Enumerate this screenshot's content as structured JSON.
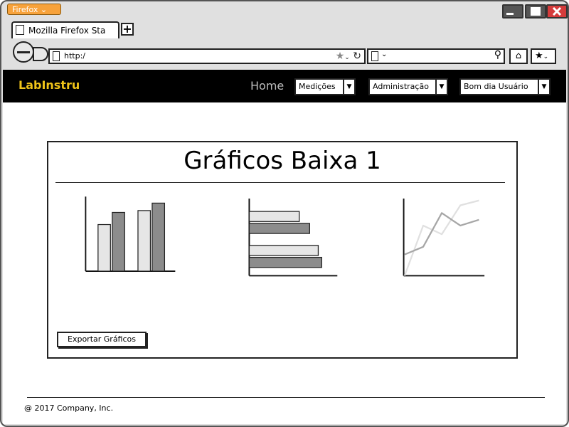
{
  "browser": {
    "menu_button": "Firefox",
    "tab_title": "Mozilla Firefox Sta",
    "new_tab": "+",
    "url": "http:/",
    "search_value": ""
  },
  "app": {
    "brand": "LabInstru",
    "nav": {
      "home": "Home",
      "menus": [
        "Medições",
        "Administração",
        "Bom dia Usuário"
      ]
    }
  },
  "panel": {
    "title": "Gráficos Baixa 1",
    "export_button": "Exportar Gráficos"
  },
  "footer": {
    "copyright": "@ 2017 Company, Inc."
  },
  "colors": {
    "brand": "#f0c419",
    "bar_light": "#e6e6e6",
    "bar_dark": "#8c8c8c",
    "line_dark": "#a6a6a6",
    "line_light": "#e0e0e0"
  },
  "chart_data": [
    {
      "type": "bar",
      "categories": [
        "",
        ""
      ],
      "series": [
        {
          "values": [
            50,
            65
          ]
        },
        {
          "values": [
            63,
            73
          ]
        }
      ],
      "ylim": [
        0,
        80
      ]
    },
    {
      "type": "bar",
      "orientation": "horizontal",
      "categories": [
        "",
        ""
      ],
      "series": [
        {
          "values": [
            58,
            80
          ]
        },
        {
          "values": [
            70,
            84
          ]
        }
      ],
      "xlim": [
        0,
        100
      ]
    },
    {
      "type": "line",
      "x": [
        0,
        1,
        2,
        3,
        4
      ],
      "series": [
        {
          "values": [
            22,
            30,
            65,
            52,
            58
          ]
        },
        {
          "values": [
            0,
            52,
            43,
            73,
            78
          ]
        }
      ],
      "ylim": [
        0,
        80
      ]
    }
  ]
}
